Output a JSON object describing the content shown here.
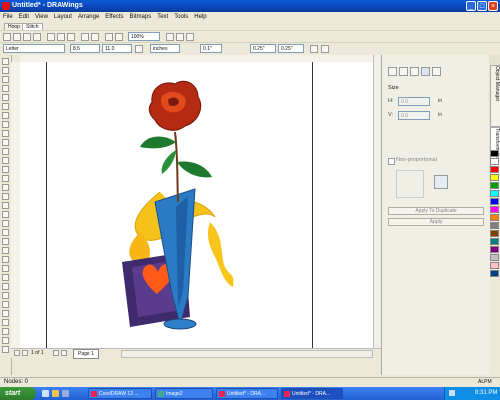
{
  "window": {
    "title": "Untitled* - DRAWings",
    "controls": [
      "_",
      "□",
      "×"
    ]
  },
  "menu": [
    "File",
    "Edit",
    "View",
    "Layout",
    "Arrange",
    "Effects",
    "Bitmaps",
    "Text",
    "Tools",
    "Help"
  ],
  "tabs": [
    "Hoop",
    "Stitch"
  ],
  "toolbar1": {
    "zoom": "100%"
  },
  "toolbar2": {
    "page_size": "Letter",
    "width": "8.5",
    "height": "11.0",
    "units": "inches",
    "nudge": "0.1\"",
    "dup_x": "0.25\"",
    "dup_y": "0.25\""
  },
  "docker": {
    "section": "Size",
    "h_label": "H:",
    "v_label": "V:",
    "h_value": "0.0",
    "v_value": "0.0",
    "unit": "in",
    "proportional": "Non-proportional",
    "apply_duplicate": "Apply To Duplicate",
    "apply": "Apply",
    "side_tabs": [
      "Object Manager",
      "Transformation"
    ]
  },
  "page_nav": {
    "position": "1 of 1",
    "page_tab": "Page 1"
  },
  "status": {
    "left": "Nodes: 0",
    "right": "ALPM"
  },
  "taskbar": {
    "start": "start",
    "tasks": [
      "CorelDRAW 12 ...",
      "Image2",
      "Untitled* - DRA...",
      "Untitled* - DRA..."
    ],
    "clock": "8:31 PM"
  },
  "colors": {
    "palette": [
      "#000000",
      "#ffffff",
      "#ff0000",
      "#ffff00",
      "#00a000",
      "#00ffff",
      "#0000ff",
      "#ff00ff",
      "#ff8000",
      "#808080",
      "#804000",
      "#008080",
      "#800080",
      "#c0c0c0",
      "#ffc0cb",
      "#004080"
    ]
  }
}
